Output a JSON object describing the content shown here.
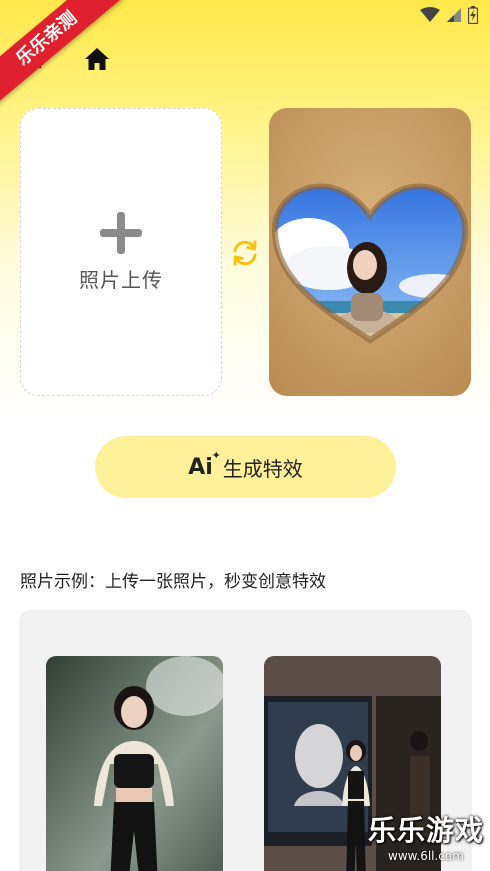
{
  "ribbon": {
    "text": "乐乐亲测"
  },
  "upload": {
    "label": "照片上传"
  },
  "generate": {
    "ai": "Ai",
    "label": "生成特效"
  },
  "examples": {
    "title": "照片示例：上传一张照片，秒变创意特效"
  },
  "watermark": {
    "main": "乐乐游戏",
    "sub": "www.6ll.com"
  }
}
